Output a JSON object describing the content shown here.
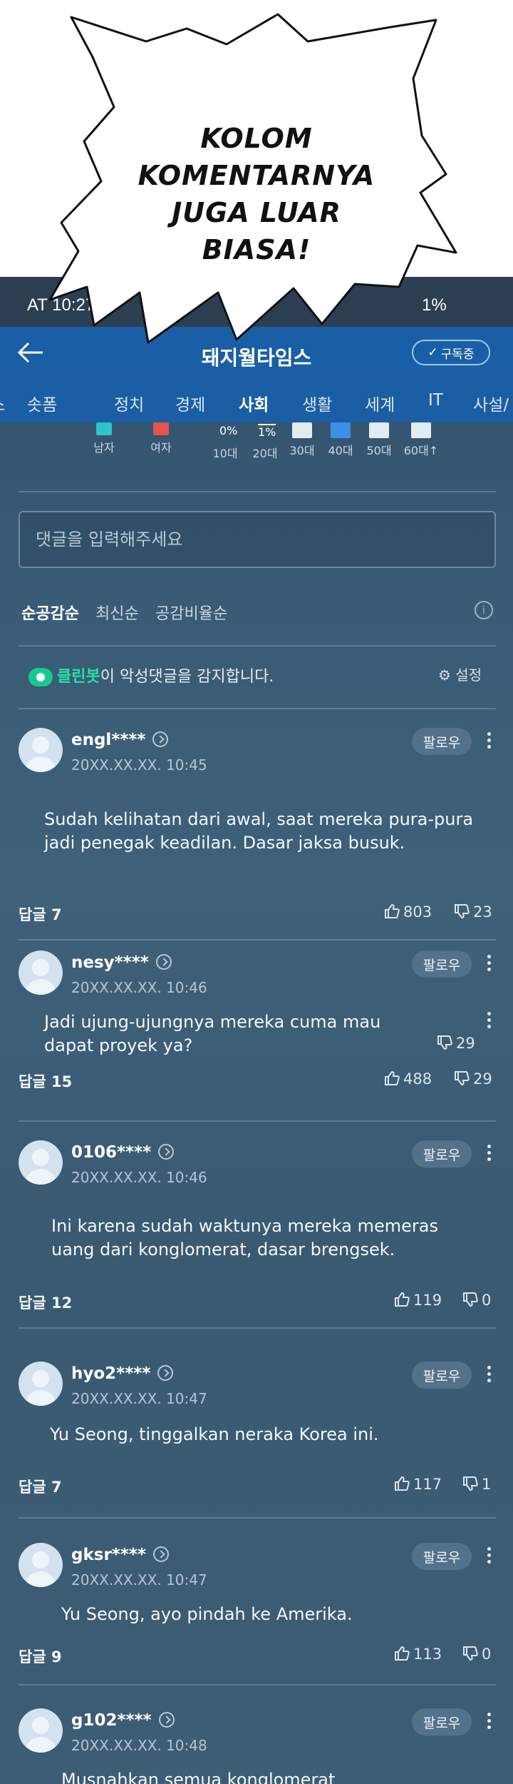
{
  "caption": [
    "KOLOM",
    "KOMENTARNYA",
    "JUGA LUAR",
    "BIASA!"
  ],
  "status_bar": {
    "time": "AT 10:27",
    "battery": "1%"
  },
  "app_bar": {
    "title": "돼지월타임스",
    "subscribe_label": "구독중"
  },
  "nav_tabs": [
    "스",
    "솟폼",
    "정치",
    "경제",
    "사회",
    "생활",
    "세계",
    "IT",
    "사설/"
  ],
  "nav_active": "사회",
  "stats": {
    "gender": [
      "남자",
      "여자"
    ],
    "ages": [
      "10대",
      "20대",
      "30대",
      "40대",
      "50대",
      "60대↑"
    ],
    "pct_10": "0%",
    "pct_20": "1%",
    "colors": {
      "male": "#2ec4c9",
      "female": "#e4544d",
      "age": "#e3ecf3",
      "age40": "#3f8ee6"
    }
  },
  "comment_input": {
    "placeholder": "댓글을 입력해주세요"
  },
  "sort": [
    "순공감순",
    "최신순",
    "공감비율순"
  ],
  "cleanbot": {
    "name": "클린봇",
    "text": "이 악성댓글을 감지합니다.",
    "settings": "설정"
  },
  "follow_label": "팔로우",
  "comments": [
    {
      "user": "engl****",
      "time": "20XX.XX.XX. 10:45",
      "text": [
        "Sudah kelihatan dari awal, saat mereka pura-pura",
        "jadi penegak keadilan. Dasar jaksa busuk."
      ],
      "reply": "답글 7",
      "likes": "803",
      "dislikes": "23"
    },
    {
      "user": "nesy****",
      "time": "20XX.XX.XX. 10:46",
      "text": [
        "Jadi ujung-ujungnya mereka cuma mau",
        "dapat proyek ya?"
      ],
      "reply": "답글 15",
      "likes": "488",
      "dislikes": "29",
      "ghost_dislikes": "29"
    },
    {
      "user": "0106****",
      "time": "20XX.XX.XX. 10:46",
      "text": [
        "Ini karena sudah waktunya mereka memeras",
        "uang dari konglomerat, dasar brengsek."
      ],
      "reply": "답글 12",
      "likes": "119",
      "dislikes": "0"
    },
    {
      "user": "hyo2****",
      "time": "20XX.XX.XX. 10:47",
      "text": [
        "Yu Seong, tinggalkan neraka Korea ini."
      ],
      "reply": "답글  7",
      "likes": "117",
      "dislikes": "1"
    },
    {
      "user": "gksr****",
      "time": "20XX.XX.XX. 10:47",
      "text": [
        "Yu Seong, ayo pindah ke Amerika."
      ],
      "reply": "답글  9",
      "likes": "113",
      "dislikes": "0"
    },
    {
      "user": "g102****",
      "time": "20XX.XX.XX. 10:48",
      "text": [
        "Musnahkan semua konglomerat"
      ],
      "reply": "",
      "likes": "",
      "dislikes": ""
    }
  ]
}
